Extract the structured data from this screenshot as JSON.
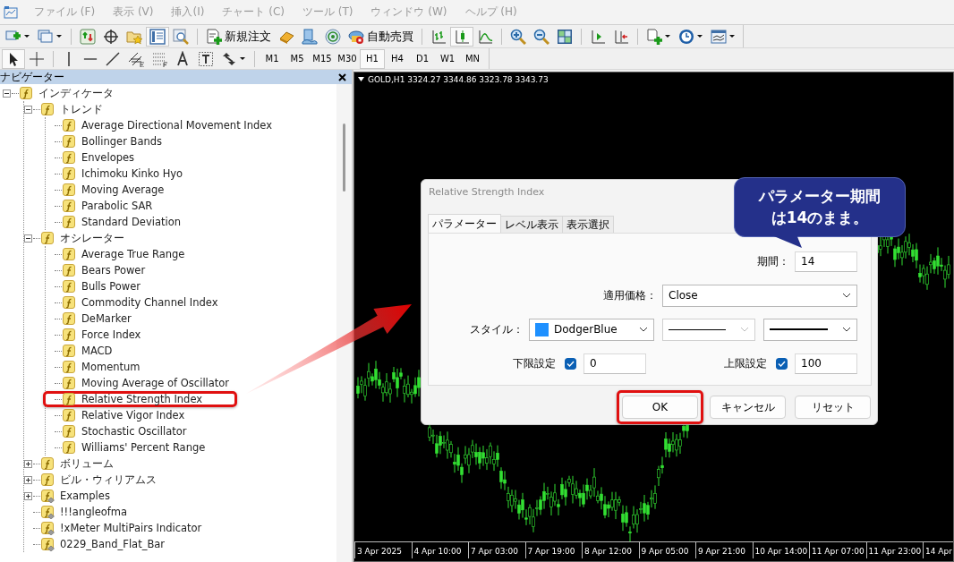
{
  "menu": [
    {
      "label": "ファイル (F)"
    },
    {
      "label": "表示 (V)"
    },
    {
      "label": "挿入(I)"
    },
    {
      "label": "チャート (C)"
    },
    {
      "label": "ツール (T)"
    },
    {
      "label": "ウィンドウ (W)"
    },
    {
      "label": "ヘルプ (H)"
    }
  ],
  "toolbar": {
    "order_button": "新規注文",
    "auto_trading_button": "自動売買"
  },
  "timeframes": [
    {
      "label": "M1",
      "selected": false
    },
    {
      "label": "M5",
      "selected": false
    },
    {
      "label": "M15",
      "selected": false
    },
    {
      "label": "M30",
      "selected": false
    },
    {
      "label": "H1",
      "selected": true
    },
    {
      "label": "H4",
      "selected": false
    },
    {
      "label": "D1",
      "selected": false
    },
    {
      "label": "W1",
      "selected": false
    },
    {
      "label": "MN",
      "selected": false
    }
  ],
  "navigator": {
    "title": "ナビゲーター",
    "tree": [
      {
        "label": "インディケータ",
        "kind": "indicator",
        "expanded": true,
        "highlighted": false,
        "children": [
          {
            "label": "トレンド",
            "kind": "indicator",
            "expanded": true,
            "highlighted": false,
            "children": [
              {
                "label": "Average Directional Movement Index",
                "kind": "indicator",
                "highlighted": false
              },
              {
                "label": "Bollinger Bands",
                "kind": "indicator",
                "highlighted": false
              },
              {
                "label": "Envelopes",
                "kind": "indicator",
                "highlighted": false
              },
              {
                "label": "Ichimoku Kinko Hyo",
                "kind": "indicator",
                "highlighted": false
              },
              {
                "label": "Moving Average",
                "kind": "indicator",
                "highlighted": false
              },
              {
                "label": "Parabolic SAR",
                "kind": "indicator",
                "highlighted": false
              },
              {
                "label": "Standard Deviation",
                "kind": "indicator",
                "highlighted": false
              }
            ]
          },
          {
            "label": "オシレーター",
            "kind": "indicator",
            "expanded": true,
            "highlighted": false,
            "children": [
              {
                "label": "Average True Range",
                "kind": "indicator",
                "highlighted": false
              },
              {
                "label": "Bears Power",
                "kind": "indicator",
                "highlighted": false
              },
              {
                "label": "Bulls Power",
                "kind": "indicator",
                "highlighted": false
              },
              {
                "label": "Commodity Channel Index",
                "kind": "indicator",
                "highlighted": false
              },
              {
                "label": "DeMarker",
                "kind": "indicator",
                "highlighted": false
              },
              {
                "label": "Force Index",
                "kind": "indicator",
                "highlighted": false
              },
              {
                "label": "MACD",
                "kind": "indicator",
                "highlighted": false
              },
              {
                "label": "Momentum",
                "kind": "indicator",
                "highlighted": false
              },
              {
                "label": "Moving Average of Oscillator",
                "kind": "indicator",
                "highlighted": false
              },
              {
                "label": "Relative Strength Index",
                "kind": "indicator",
                "highlighted": true
              },
              {
                "label": "Relative Vigor Index",
                "kind": "indicator",
                "highlighted": false
              },
              {
                "label": "Stochastic Oscillator",
                "kind": "indicator",
                "highlighted": false
              },
              {
                "label": "Williams' Percent Range",
                "kind": "indicator",
                "highlighted": false
              }
            ]
          },
          {
            "label": "ボリューム",
            "kind": "indicator",
            "expanded": false,
            "highlighted": false
          },
          {
            "label": "ビル・ウィリアムス",
            "kind": "indicator",
            "expanded": false,
            "highlighted": false
          },
          {
            "label": "Examples",
            "kind": "custom",
            "expanded": false,
            "highlighted": false
          },
          {
            "label": "!!!angleofma",
            "kind": "custom",
            "highlighted": false
          },
          {
            "label": "!xMeter MultiPairs Indicator",
            "kind": "custom",
            "highlighted": false
          },
          {
            "label": "0229_Band_Flat_Bar",
            "kind": "custom",
            "highlighted": false
          }
        ]
      }
    ]
  },
  "chart": {
    "header": "GOLD,H1  3324.27 3344.86 3323.78 3343.73",
    "time_labels": [
      "3 Apr 2025",
      "4 Apr 10:00",
      "7 Apr 03:00",
      "7 Apr 19:00",
      "8 Apr 12:00",
      "9 Apr 05:00",
      "9 Apr 21:00",
      "10 Apr 14:00",
      "11 Apr 07:00",
      "11 Apr 23:00",
      "14 Apr"
    ]
  },
  "dialog": {
    "title": "Relative Strength Index",
    "tabs": [
      {
        "label": "パラメーター",
        "selected": true
      },
      {
        "label": "レベル表示",
        "selected": false
      },
      {
        "label": "表示選択",
        "selected": false
      }
    ],
    "period": {
      "label": "期間：",
      "value": "14"
    },
    "price": {
      "label": "適用価格：",
      "value": "Close"
    },
    "style": {
      "label": "スタイル：",
      "color_name": "DodgerBlue",
      "color": "#1e90ff"
    },
    "min": {
      "label": "下限設定",
      "checked": true,
      "value": "0"
    },
    "max": {
      "label": "上限設定",
      "checked": true,
      "value": "100"
    },
    "buttons": [
      {
        "label": "OK",
        "highlighted": true
      },
      {
        "label": "キャンセル",
        "highlighted": false
      },
      {
        "label": "リセット",
        "highlighted": false
      }
    ]
  },
  "callout": {
    "lines": [
      "パラメーター期間",
      "は14のまま。"
    ]
  }
}
